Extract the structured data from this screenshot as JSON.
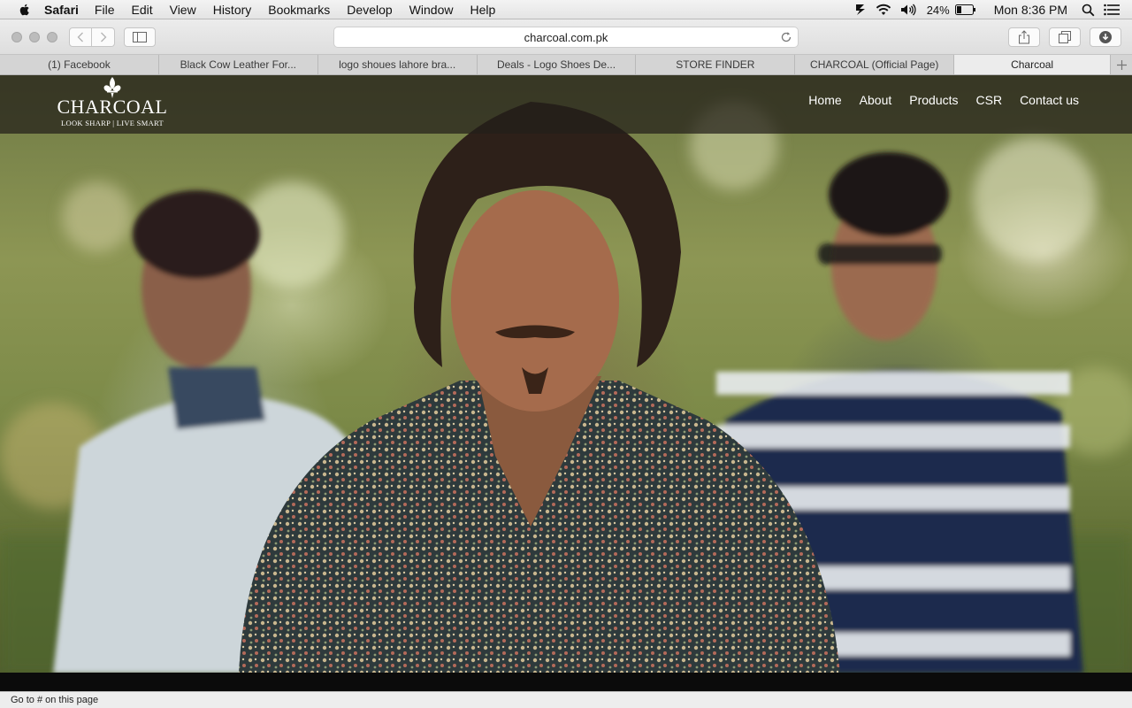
{
  "menubar": {
    "app_name": "Safari",
    "items": [
      "File",
      "Edit",
      "View",
      "History",
      "Bookmarks",
      "Develop",
      "Window",
      "Help"
    ],
    "battery_percent": "24%",
    "clock": "Mon 8:36 PM",
    "icons": [
      "apple-icon",
      "malwarebytes-icon",
      "wifi-icon",
      "volume-icon",
      "battery-icon",
      "spotlight-icon",
      "notification-center-icon"
    ]
  },
  "toolbar": {
    "url": "charcoal.com.pk",
    "icons": [
      "back-icon",
      "forward-icon",
      "sidebar-icon",
      "reload-icon",
      "share-icon",
      "tabs-overview-icon",
      "downloads-icon"
    ]
  },
  "tabs": [
    {
      "label": "(1) Facebook",
      "active": false
    },
    {
      "label": "Black Cow Leather For...",
      "active": false
    },
    {
      "label": "logo shoues lahore bra...",
      "active": false
    },
    {
      "label": "Deals - Logo Shoes De...",
      "active": false
    },
    {
      "label": "STORE FINDER",
      "active": false
    },
    {
      "label": "CHARCOAL (Official Page)",
      "active": false
    },
    {
      "label": "Charcoal",
      "active": true
    }
  ],
  "site": {
    "logo_word": "CHARCOAL",
    "tagline": "LOOK SHARP | LIVE SMART",
    "nav": [
      "Home",
      "About",
      "Products",
      "CSR",
      "Contact us"
    ]
  },
  "status": "Go to # on this page",
  "colors": {
    "header_overlay": "#231e19",
    "nav_text": "#ffffff",
    "menubar_bg": "#ececec"
  }
}
